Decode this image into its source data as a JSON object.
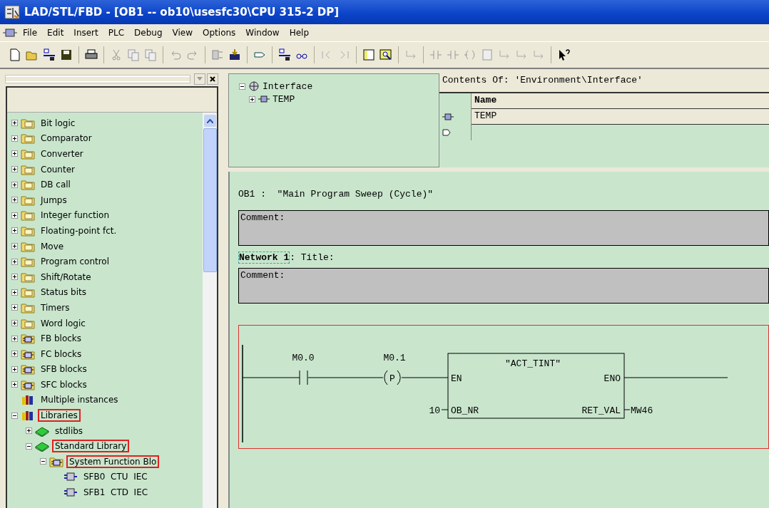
{
  "window": {
    "title": "LAD/STL/FBD  - [OB1 -- ob10\\usesfc30\\CPU 315-2 DP]"
  },
  "menu": [
    "File",
    "Edit",
    "Insert",
    "PLC",
    "Debug",
    "View",
    "Options",
    "Window",
    "Help"
  ],
  "catalog": {
    "items": [
      {
        "label": "Bit logic",
        "kind": "folder",
        "expanded": false,
        "marked": false
      },
      {
        "label": "Comparator",
        "kind": "folder",
        "expanded": false,
        "marked": false
      },
      {
        "label": "Converter",
        "kind": "folder",
        "expanded": false,
        "marked": false
      },
      {
        "label": "Counter",
        "kind": "folder",
        "expanded": false,
        "marked": false
      },
      {
        "label": "DB call",
        "kind": "folder",
        "expanded": false,
        "marked": false
      },
      {
        "label": "Jumps",
        "kind": "folder",
        "expanded": false,
        "marked": false
      },
      {
        "label": "Integer function",
        "kind": "folder",
        "expanded": false,
        "marked": false
      },
      {
        "label": "Floating-point fct.",
        "kind": "folder",
        "expanded": false,
        "marked": false
      },
      {
        "label": "Move",
        "kind": "folder",
        "expanded": false,
        "marked": false
      },
      {
        "label": "Program control",
        "kind": "folder",
        "expanded": false,
        "marked": false
      },
      {
        "label": "Shift/Rotate",
        "kind": "folder",
        "expanded": false,
        "marked": false
      },
      {
        "label": "Status bits",
        "kind": "folder",
        "expanded": false,
        "marked": false
      },
      {
        "label": "Timers",
        "kind": "folder",
        "expanded": false,
        "marked": false
      },
      {
        "label": "Word logic",
        "kind": "folder",
        "expanded": false,
        "marked": false
      },
      {
        "label": "FB blocks",
        "kind": "block-folder",
        "expanded": false,
        "marked": false
      },
      {
        "label": "FC blocks",
        "kind": "block-folder",
        "expanded": false,
        "marked": false
      },
      {
        "label": "SFB blocks",
        "kind": "block-folder",
        "expanded": false,
        "marked": false
      },
      {
        "label": "SFC blocks",
        "kind": "block-folder",
        "expanded": false,
        "marked": false
      },
      {
        "label": "Multiple instances",
        "kind": "instances",
        "marked": false
      },
      {
        "label": "Libraries",
        "kind": "instances",
        "expanded": true,
        "marked": true,
        "children": [
          {
            "label": "stdlibs",
            "kind": "book",
            "expanded": false,
            "marked": false
          },
          {
            "label": "Standard Library",
            "kind": "book",
            "expanded": true,
            "marked": true,
            "children": [
              {
                "label": "System Function Blo",
                "kind": "block-folder",
                "expanded": true,
                "marked": true,
                "children": [
                  {
                    "label": "SFB0  CTU  IEC",
                    "kind": "block",
                    "marked": false
                  },
                  {
                    "label": "SFB1  CTD  IEC",
                    "kind": "block",
                    "marked": false
                  }
                ]
              }
            ]
          }
        ]
      }
    ]
  },
  "interface": {
    "tree": {
      "label": "Interface",
      "expanded": true,
      "children": [
        {
          "label": "TEMP",
          "expanded": false
        }
      ]
    },
    "contents_title": "Contents Of: 'Environment\\Interface'",
    "column": "Name",
    "rows": [
      "TEMP",
      ""
    ]
  },
  "block": {
    "title": "OB1 :  ″Main Program Sweep (Cycle)″",
    "comment": "Comment:"
  },
  "networks": [
    {
      "label": "Network 1",
      "title": ": Title:",
      "comment": "Comment:",
      "contact": {
        "address": "M0.0"
      },
      "coil": {
        "address": "M0.1",
        "type": "P"
      },
      "box": {
        "name": "″ACT_TINT″",
        "in_en": "EN",
        "out_eno": "ENO",
        "in_param": "OB_NR",
        "in_value": "10",
        "out_param": "RET_VAL",
        "out_value": "MW46"
      }
    }
  ]
}
